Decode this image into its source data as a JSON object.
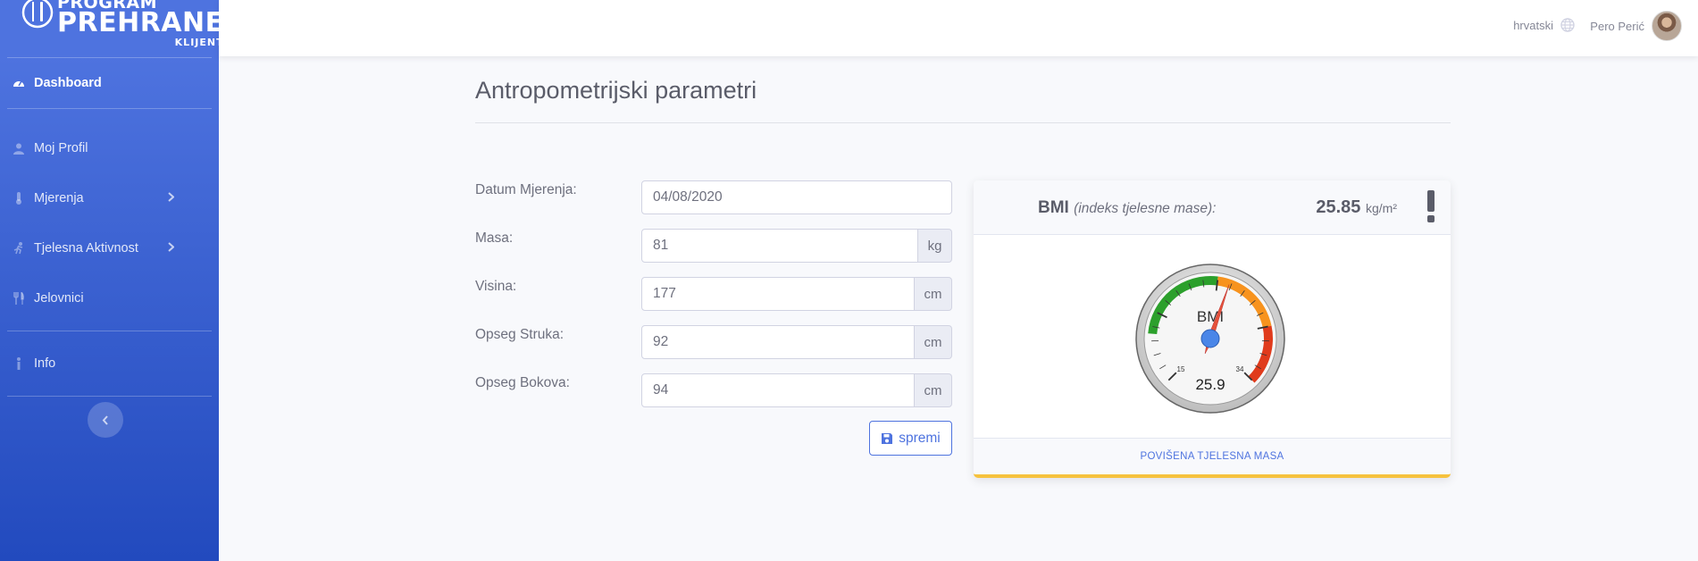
{
  "brand": {
    "line1": "PROGRAM",
    "line2": "PREHRANE",
    "line3": "KLIJENT"
  },
  "sidebar": {
    "items": [
      {
        "label": "Dashboard",
        "icon": "tachometer-icon"
      },
      {
        "label": "Moj Profil",
        "icon": "user-icon"
      },
      {
        "label": "Mjerenja",
        "icon": "thermometer-icon"
      },
      {
        "label": "Tjelesna Aktivnost",
        "icon": "running-icon"
      },
      {
        "label": "Jelovnici",
        "icon": "utensils-icon"
      },
      {
        "label": "Info",
        "icon": "info-icon"
      }
    ]
  },
  "topbar": {
    "language": "hrvatski",
    "user_name": "Pero Perić"
  },
  "page": {
    "title": "Antropometrijski parametri"
  },
  "form": {
    "fields": [
      {
        "label": "Datum Mjerenja:",
        "value": "04/08/2020",
        "unit": ""
      },
      {
        "label": "Masa:",
        "value": "81",
        "unit": "kg"
      },
      {
        "label": "Visina:",
        "value": "177",
        "unit": "cm"
      },
      {
        "label": "Opseg Struka:",
        "value": "92",
        "unit": "cm"
      },
      {
        "label": "Opseg Bokova:",
        "value": "94",
        "unit": "cm"
      }
    ],
    "save_label": "spremi"
  },
  "bmi_card": {
    "title": "BMI",
    "subtitle": "(indeks tjelesne mase):",
    "value": "25.85",
    "unit": "kg/m²",
    "gauge": {
      "label": "BMI",
      "display": "25.9",
      "min_label": "15",
      "max_label": "34",
      "min": 15,
      "max": 34,
      "value": 25.85
    },
    "status": "POVIŠENA TJELESNA MASA",
    "status_color": "#f6c23e"
  },
  "colors": {
    "primary": "#4e73df",
    "warning": "#f6c23e",
    "green": "#2ca02c",
    "orange": "#f7931e",
    "red": "#e03b1c"
  }
}
